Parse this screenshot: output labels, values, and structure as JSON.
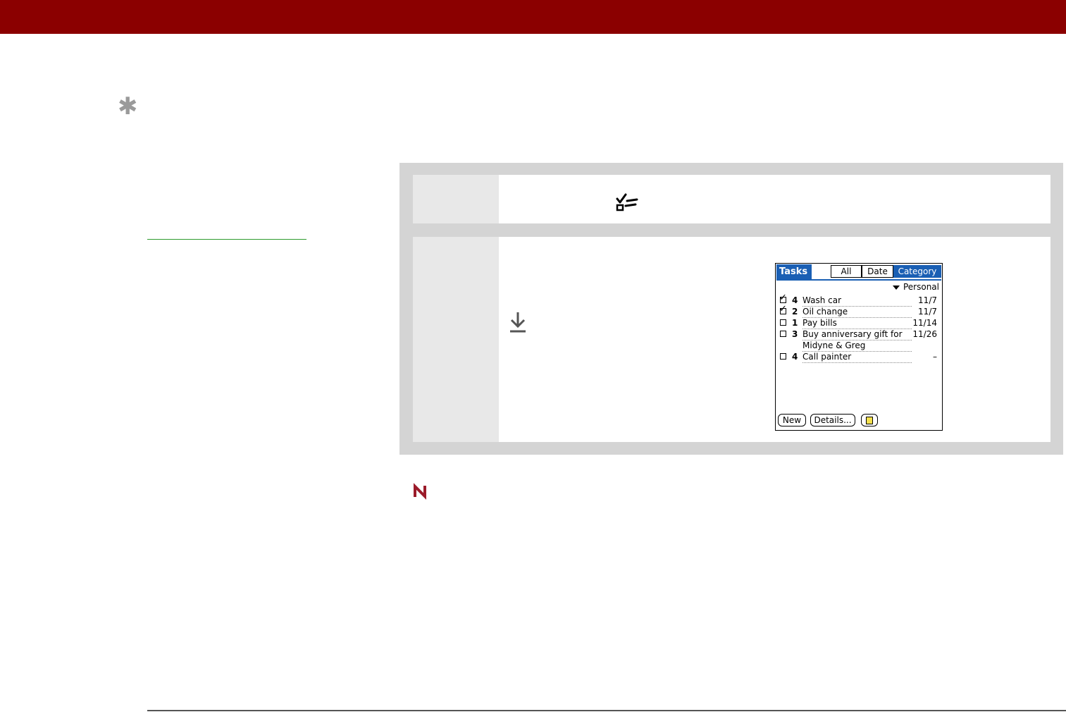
{
  "icons": {
    "tip": "asterisk-icon",
    "tasks_app": "tasks-checklist-icon",
    "step_arrow": "down-arrow-icon",
    "note": "note-mark-icon"
  },
  "colors": {
    "header": "#8b0000",
    "link_underline": "#2e9b2e",
    "palm_accent": "#1a5fb4"
  },
  "palm_screen": {
    "title": "Tasks",
    "tabs": [
      "All",
      "Date",
      "Category"
    ],
    "selected_tab": "Category",
    "category": "Personal",
    "tasks": [
      {
        "done": true,
        "priority": "4",
        "description": "Wash car",
        "due": "11/7"
      },
      {
        "done": true,
        "priority": "2",
        "description": "Oil change",
        "due": "11/7"
      },
      {
        "done": false,
        "priority": "1",
        "description": "Pay bills",
        "due": "11/14"
      },
      {
        "done": false,
        "priority": "3",
        "description": "Buy anniversary gift for",
        "due": "11/26"
      },
      {
        "continuation": true,
        "description": "Midyne & Greg"
      },
      {
        "done": false,
        "priority": "4",
        "description": "Call painter",
        "due": "–"
      }
    ],
    "buttons": {
      "new": "New",
      "details": "Details..."
    }
  }
}
